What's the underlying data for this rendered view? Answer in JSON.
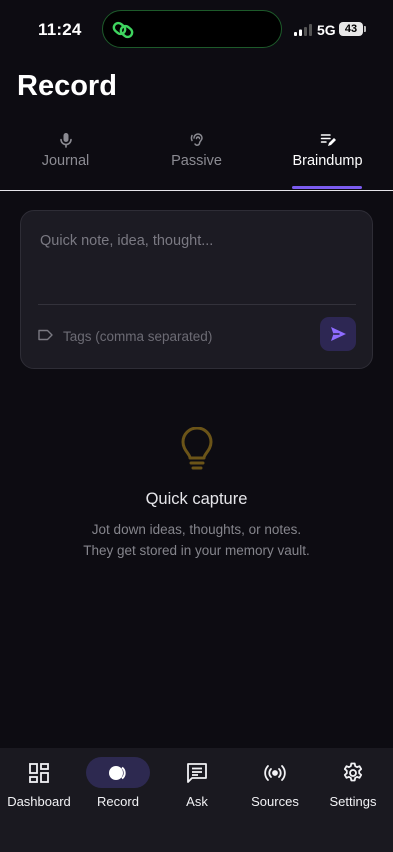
{
  "status": {
    "time": "11:24",
    "network": "5G",
    "battery": "43"
  },
  "page": {
    "title": "Record"
  },
  "tabs": [
    {
      "label": "Journal",
      "icon": "mic-icon",
      "active": false
    },
    {
      "label": "Passive",
      "icon": "ear-icon",
      "active": false
    },
    {
      "label": "Braindump",
      "icon": "edit-list-icon",
      "active": true
    }
  ],
  "composer": {
    "note_placeholder": "Quick note, idea, thought...",
    "note_value": "",
    "tags_placeholder": "Tags (comma separated)",
    "tags_value": ""
  },
  "empty_state": {
    "title": "Quick capture",
    "line1": "Jot down ideas, thoughts, or notes.",
    "line2": "They get stored in your memory vault."
  },
  "nav": [
    {
      "label": "Dashboard",
      "icon": "dashboard-icon"
    },
    {
      "label": "Record",
      "icon": "record-icon",
      "active": true
    },
    {
      "label": "Ask",
      "icon": "chat-icon"
    },
    {
      "label": "Sources",
      "icon": "broadcast-icon"
    },
    {
      "label": "Settings",
      "icon": "gear-icon"
    }
  ],
  "colors": {
    "accent": "#7b5cf0",
    "bulb": "#6b5418",
    "island_green": "#3fd45f"
  }
}
